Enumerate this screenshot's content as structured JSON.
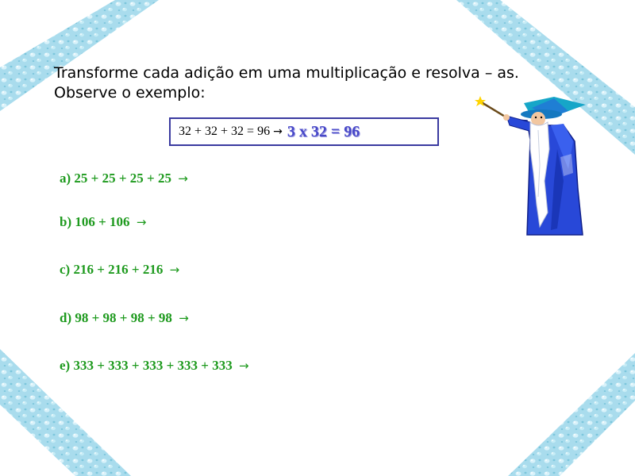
{
  "title": {
    "line1": "Transforme cada adição em uma multiplicação e resolva – as.",
    "line2": "Observe o exemplo:"
  },
  "example": {
    "sum": "32 + 32 + 32 = 96",
    "arrow": "→",
    "answer": "3 x 32 = 96"
  },
  "exercises": [
    {
      "text": "a) 25 + 25 + 25 + 25",
      "arrow": "→"
    },
    {
      "text": "b) 106 + 106",
      "arrow": "→"
    },
    {
      "text": "c) 216 + 216 + 216",
      "arrow": "→"
    },
    {
      "text": "d) 98 + 98 + 98 + 98",
      "arrow": "→"
    },
    {
      "text": "e) 333 + 333 + 333 + 333 + 333",
      "arrow": "→"
    }
  ],
  "colors": {
    "exercise_text": "#1e9a1e",
    "example_answer": "#4848c8",
    "example_border": "#3a3aa0",
    "ribbon": "#a8dcec",
    "wizard_robe": "#2848d8"
  },
  "icons": {
    "decoration": "water-drop-ribbon",
    "illustration": "wizard-with-wand"
  }
}
